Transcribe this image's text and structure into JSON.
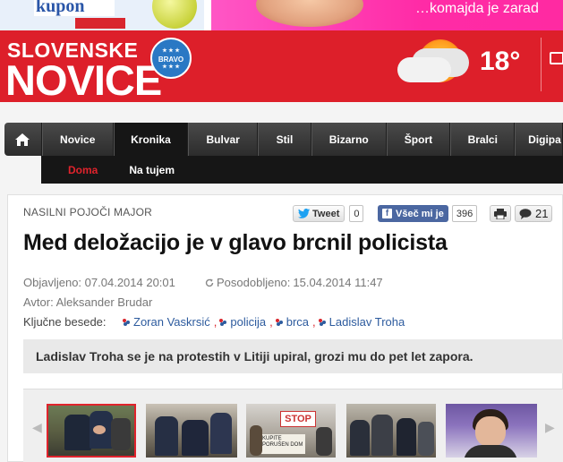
{
  "ads": {
    "left_brand": "kupon",
    "right_text": "…komajda je zarad"
  },
  "header": {
    "logo_top": "SLOVENSKE",
    "logo_bottom": "NOVICE",
    "badge_text": "BRAVO",
    "temperature": "18°"
  },
  "nav": {
    "items": [
      "Novice",
      "Kronika",
      "Bulvar",
      "Stil",
      "Bizarno",
      "Šport",
      "Bralci",
      "Digipa"
    ],
    "active_index": 1,
    "sub_items": [
      "Doma",
      "Na tujem"
    ],
    "sub_active_index": 0
  },
  "article": {
    "kicker": "NASILNI POJOČI MAJOR",
    "title": "Med deložacijo je v glavo brcnil policista",
    "published_label": "Objavljeno:",
    "published": "07.04.2014 20:01",
    "updated_label": "Posodobljeno:",
    "updated": "15.04.2014 11:47",
    "author_label": "Avtor:",
    "author": "Aleksander Brudar",
    "keywords_label": "Ključne besede:",
    "keywords": [
      "Zoran Vaskrsić",
      "policija",
      "brca",
      "Ladislav Troha"
    ],
    "summary": "Ladislav Troha se je na protestih v Litiji upiral, grozi mu do pet let zapora."
  },
  "share": {
    "tweet_label": "Tweet",
    "tweet_count": "0",
    "fb_label": "Všeč mi je",
    "fb_count": "396",
    "comments_count": "21"
  },
  "gallery": {
    "thumb_count": 6,
    "selected_index": 0,
    "stop_sign": "STOP",
    "sign_text": "KUPITE PORUŠEN DOM"
  },
  "colors": {
    "brand_red": "#dd1f2a",
    "nav_dark": "#2c2c2c",
    "link_blue": "#2d5b9e",
    "active_red": "#e0232c"
  }
}
